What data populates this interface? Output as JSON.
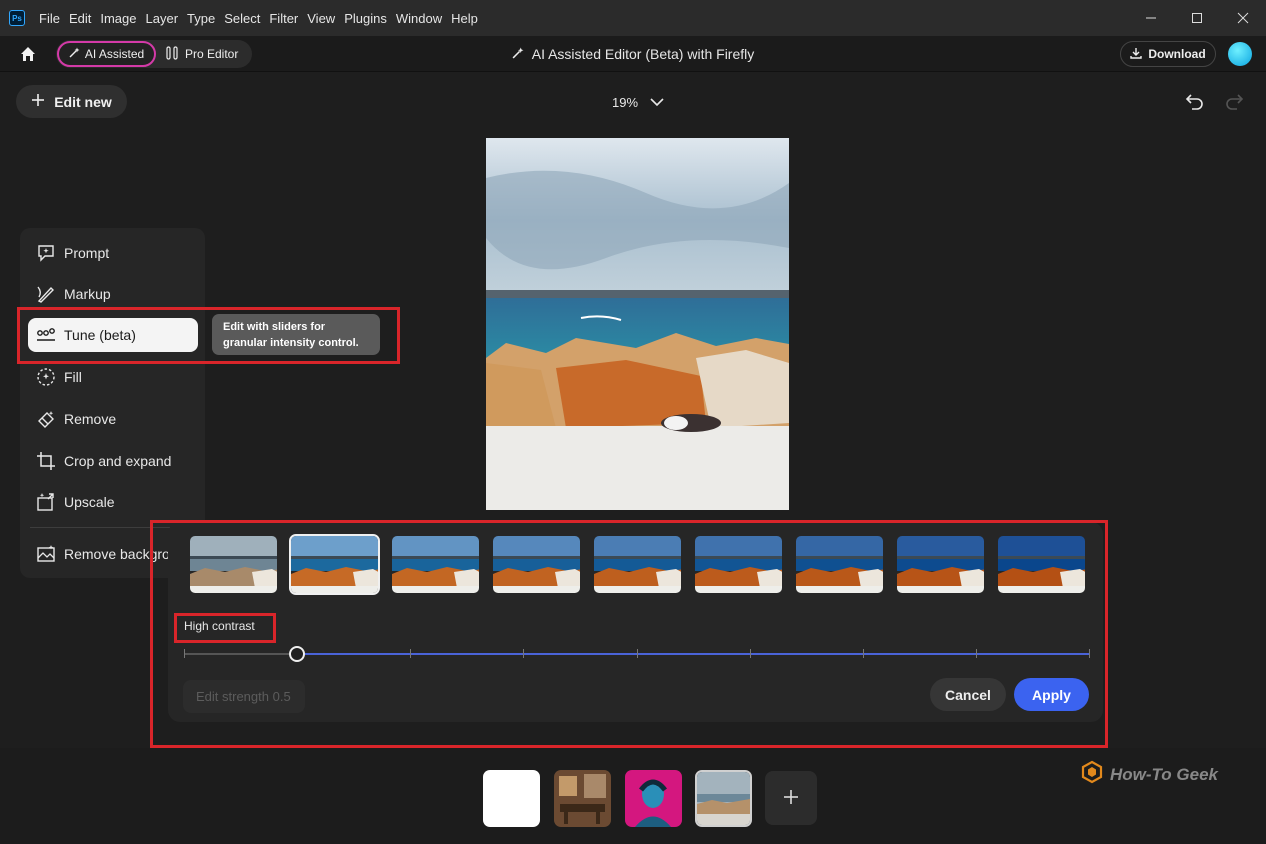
{
  "menubar": {
    "app_icon": "Ps",
    "items": [
      "File",
      "Edit",
      "Image",
      "Layer",
      "Type",
      "Select",
      "Filter",
      "View",
      "Plugins",
      "Window",
      "Help"
    ]
  },
  "header": {
    "ai_assisted_label": "AI Assisted",
    "pro_editor_label": "Pro Editor",
    "title": "AI Assisted Editor (Beta) with Firefly",
    "download_label": "Download"
  },
  "toolbar": {
    "edit_new_label": "Edit new",
    "zoom": "19%"
  },
  "tools": [
    {
      "label": "Prompt",
      "icon": "prompt-icon"
    },
    {
      "label": "Markup",
      "icon": "markup-icon"
    },
    {
      "label": "Tune (beta)",
      "icon": "tune-icon",
      "active": true
    },
    {
      "label": "Fill",
      "icon": "fill-icon"
    },
    {
      "label": "Remove",
      "icon": "remove-icon"
    },
    {
      "label": "Crop and expand",
      "icon": "crop-icon"
    },
    {
      "label": "Upscale",
      "icon": "upscale-icon"
    },
    {
      "label": "Remove backgrou",
      "icon": "remove-background-icon"
    }
  ],
  "tooltip": "Edit with sliders for granular intensity control.",
  "tune": {
    "preset_label": "High contrast",
    "selected_preset": 2,
    "preset_count": 9,
    "strength_fraction": 0.125,
    "edit_strength_placeholder": "Edit strength 0.5",
    "cancel_label": "Cancel",
    "apply_label": "Apply"
  },
  "watermark": "How-To Geek",
  "colors": {
    "accent_blue": "#3b63f0",
    "highlight_red": "#d9252a",
    "ai_assisted_border": "#d43aa8"
  }
}
